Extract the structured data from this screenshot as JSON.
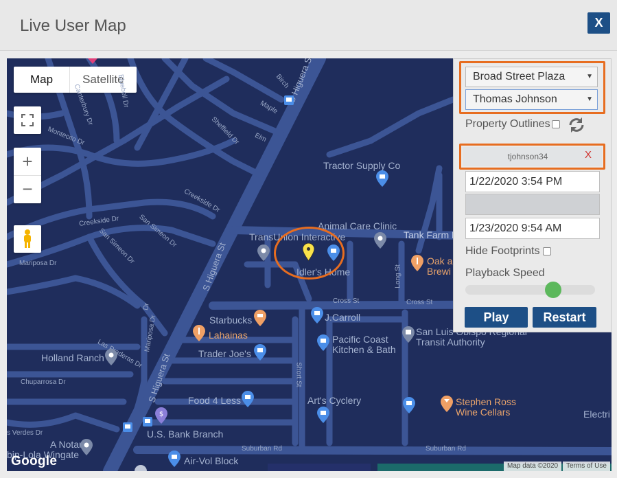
{
  "dialog": {
    "title": "Live User Map",
    "close_label": "X"
  },
  "map": {
    "type_map": "Map",
    "type_satellite": "Satellite",
    "zoom_in": "+",
    "zoom_out": "−",
    "google": "Google",
    "map_data": "Map data ©2020",
    "terms": "Terms of Use",
    "streets": {
      "birch": "Birch",
      "maple": "Maple",
      "elm": "Elm",
      "sheffield": "Sheffield Dr",
      "canterbury": "Canterbury Dr",
      "bluebell": "Bluebell Dr",
      "montecito": "Montecito Dr",
      "creekside1": "Creekside Dr",
      "creekside2": "Creekside Dr",
      "san_simeon1": "San Simeon Dr",
      "san_simeon2": "San Simeon Dr",
      "mariposa1": "Mariposa Dr",
      "mariposa2": "Mariposa Dr",
      "las_praderas": "Las Praderas Dr",
      "chuparrosa": "Chuparrosa Dr",
      "verdes": "s Verdes Dr",
      "s_higuera_top": "S Higuera S",
      "s_higuera_mid": "S Higuera St",
      "s_higuera_low": "S Higuera St",
      "tank_farm": "Tank Farm R",
      "long_st": "Long St",
      "cross_st1": "Cross St",
      "cross_st2": "Cross St",
      "short_st": "Short St",
      "suburban1": "Suburban Rd",
      "suburban2": "Suburban Rd",
      "dr": "Dr"
    },
    "pois": {
      "tractor": "Tractor Supply Co",
      "animal": "Animal Care Clinic",
      "transunion": "TransUnion Interactive",
      "idler": "Idler's Home",
      "oak": "Oak a",
      "brewi": "Brewi",
      "jcarroll": "J.Carroll",
      "starbucks": "Starbucks",
      "lahainas": "Lahainas",
      "traderjoes": "Trader Joe's",
      "pacific1": "Pacific Coast",
      "pacific2": "Kitchen & Bath",
      "slo1": "San Luis Obispo Regional",
      "slo2": "Transit Authority",
      "holland": "Holland Ranch",
      "food4less": "Food 4 Less",
      "arts": "Art's Cyclery",
      "stephen1": "Stephen Ross",
      "stephen2": "Wine Cellars",
      "usbank": "U.S. Bank Branch",
      "notary1": "A Notary",
      "notary2": "bip-Lola Wingate",
      "airvol": "Air-Vol Block",
      "electri": "Electri"
    }
  },
  "panel": {
    "property_select": "Broad Street Plaza",
    "user_select": "Thomas Johnson",
    "property_outlines": "Property Outlines",
    "username": "tjohnson34",
    "remove_label": "X",
    "start_time": "1/22/2020 3:54 PM",
    "end_time": "1/23/2020 9:54 AM",
    "hide_footprints": "Hide Footprints",
    "playback_speed": "Playback Speed",
    "playback_level": 0.7,
    "play_label": "Play",
    "restart_label": "Restart"
  },
  "colors": {
    "accent": "#1d4f86",
    "highlight": "#e76d20",
    "map_bg": "#1f2d5c",
    "road": "#3c5595"
  }
}
